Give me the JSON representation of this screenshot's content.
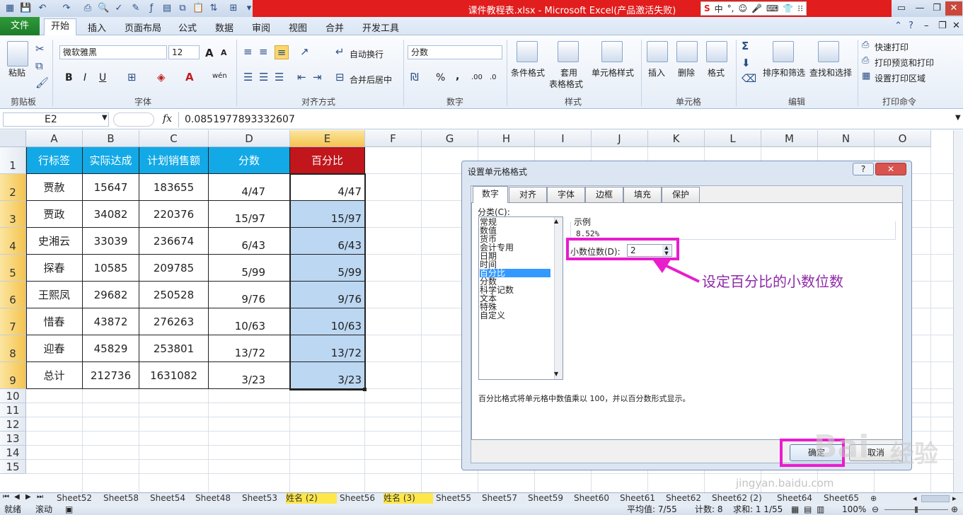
{
  "title_bar": {
    "title": "课件教程表.xlsx - Microsoft Excel(产品激活失败)",
    "ime": {
      "s_logo": "S",
      "lang": "中",
      "punct": "°,"
    }
  },
  "menu": {
    "file": "文件",
    "tabs": [
      "开始",
      "插入",
      "页面布局",
      "公式",
      "数据",
      "审阅",
      "视图",
      "合并",
      "开发工具"
    ]
  },
  "ribbon": {
    "clipboard": {
      "paste": "粘贴",
      "label": "剪贴板"
    },
    "font": {
      "name": "微软雅黑",
      "size": "12",
      "label": "字体",
      "bold": "B",
      "italic": "I",
      "underline": "U",
      "grow": "A",
      "shrink": "A",
      "font_color": "A",
      "phonetic": "wén"
    },
    "alignment": {
      "wrap": "自动换行",
      "merge": "合并后居中",
      "label": "对齐方式"
    },
    "number": {
      "format": "分数",
      "percent": "%",
      "comma": ",",
      "inc_decimal": ".00",
      "dec_decimal": ".0",
      "label": "数字"
    },
    "styles": {
      "conditional": "条件格式",
      "table1": "套用",
      "table2": "表格格式",
      "cell_style": "单元格样式",
      "label": "样式"
    },
    "cells": {
      "insert": "插入",
      "delete": "删除",
      "format": "格式",
      "label": "单元格"
    },
    "editing": {
      "sigma": "Σ",
      "sort": "排序和筛选",
      "find": "查找和选择",
      "label": "编辑"
    },
    "print": {
      "quick": "快速打印",
      "preview": "打印预览和打印",
      "area": "设置打印区域",
      "label": "打印命令"
    }
  },
  "formula_bar": {
    "name_box": "E2",
    "fx": "fx",
    "value": "0.0851977893332607"
  },
  "columns": [
    "A",
    "B",
    "C",
    "D",
    "E",
    "F",
    "G",
    "H",
    "I",
    "J",
    "K",
    "L",
    "M",
    "N",
    "O"
  ],
  "rows": [
    "1",
    "2",
    "3",
    "4",
    "5",
    "6",
    "7",
    "8",
    "9",
    "10",
    "11",
    "12",
    "13",
    "14",
    "15"
  ],
  "table": {
    "headers": [
      "行标签",
      "实际达成",
      "计划销售额",
      "分数",
      "百分比"
    ],
    "rows": [
      [
        "贾赦",
        "15647",
        "183655",
        "4/47",
        "4/47"
      ],
      [
        "贾政",
        "34082",
        "220376",
        "15/97",
        "15/97"
      ],
      [
        "史湘云",
        "33039",
        "236674",
        "6/43",
        "6/43"
      ],
      [
        "探春",
        "10585",
        "209785",
        "5/99",
        "5/99"
      ],
      [
        "王熙凤",
        "29682",
        "250528",
        "9/76",
        "9/76"
      ],
      [
        "惜春",
        "43872",
        "276263",
        "10/63",
        "10/63"
      ],
      [
        "迎春",
        "45829",
        "253801",
        "13/72",
        "13/72"
      ],
      [
        "总计",
        "212736",
        "1631082",
        "3/23",
        "3/23"
      ]
    ]
  },
  "dialog": {
    "title": "设置单元格格式",
    "help": "?",
    "close": "✕",
    "tabs": [
      "数字",
      "对齐",
      "字体",
      "边框",
      "填充",
      "保护"
    ],
    "category_label": "分类(C):",
    "categories": [
      "常规",
      "数值",
      "货币",
      "会计专用",
      "日期",
      "时间",
      "百分比",
      "分数",
      "科学记数",
      "文本",
      "特殊",
      "自定义"
    ],
    "selected_category": "百分比",
    "sample_label": "示例",
    "sample_value": "8.52%",
    "decimal_label": "小数位数(D):",
    "decimal_value": "2",
    "description": "百分比格式将单元格中数值乘以 100，并以百分数形式显示。",
    "ok": "确定",
    "cancel": "取消",
    "annotation": "设定百分比的小数位数",
    "accent_color": "#e81dce"
  },
  "sheet_tabs": [
    "Sheet52",
    "Sheet58",
    "Sheet54",
    "Sheet48",
    "Sheet53",
    "姓名 (2)",
    "Sheet56",
    "姓名 (3)",
    "Sheet55",
    "Sheet57",
    "Sheet59",
    "Sheet60",
    "Sheet61",
    "Sheet62",
    "Sheet62 (2)",
    "Sheet64",
    "Sheet65"
  ],
  "status": {
    "ready": "就绪",
    "scroll": "滚动",
    "avg": "平均值: 7/55",
    "count": "计数: 8",
    "sum": "求和: 1 1/55",
    "zoom": "100%"
  },
  "watermark": {
    "brand": "Bai",
    "text": "经验",
    "url": "jingyan.baidu.com"
  }
}
